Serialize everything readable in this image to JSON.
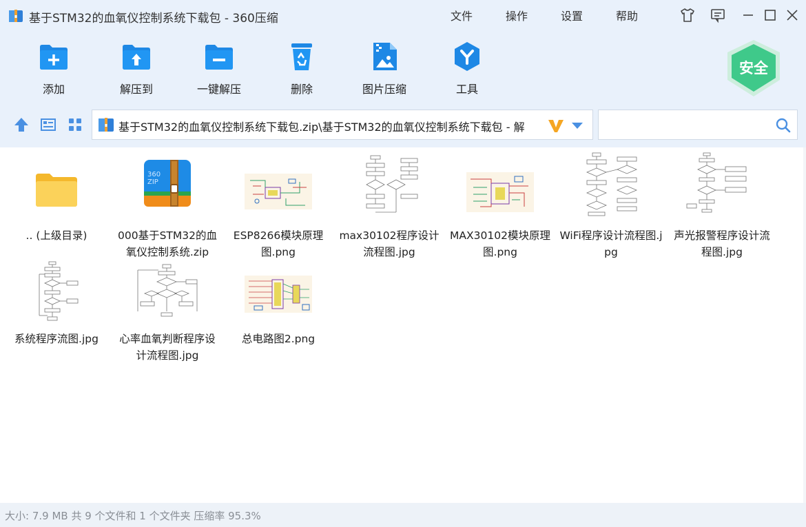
{
  "window": {
    "title": "基于STM32的血氧仪控制系统下载包 - 360压缩"
  },
  "menu": {
    "items": [
      "文件",
      "操作",
      "设置",
      "帮助"
    ]
  },
  "toolbar": {
    "add_label": "添加",
    "extract_to_label": "解压到",
    "one_click_extract_label": "一键解压",
    "delete_label": "删除",
    "image_compress_label": "图片压缩",
    "tools_label": "工具",
    "security_badge": "安全"
  },
  "address": {
    "path": "基于STM32的血氧仪控制系统下载包.zip\\基于STM32的血氧仪控制系统下载包 - 解"
  },
  "search": {
    "value": "",
    "placeholder": ""
  },
  "files": [
    {
      "name": ".. (上级目录)",
      "type": "folder-up"
    },
    {
      "name": "000基于STM32的血氧仪控制系统.zip",
      "type": "zip"
    },
    {
      "name": "ESP8266模块原理图.png",
      "type": "schematic"
    },
    {
      "name": "max30102程序设计流程图.jpg",
      "type": "flowchart"
    },
    {
      "name": "MAX30102模块原理图.png",
      "type": "schematic"
    },
    {
      "name": "WiFi程序设计流程图.jpg",
      "type": "flowchart"
    },
    {
      "name": "声光报警程序设计流程图.jpg",
      "type": "flowchart"
    },
    {
      "name": "系统程序流图.jpg",
      "type": "flowchart"
    },
    {
      "name": "心率血氧判断程序设计流程图.jpg",
      "type": "flowchart"
    },
    {
      "name": "总电路图2.png",
      "type": "schematic"
    }
  ],
  "status": {
    "text": "大小: 7.9 MB 共 9 个文件和 1 个文件夹 压缩率 95.3%"
  },
  "colors": {
    "accent_blue": "#1e88e5",
    "toolbar_bg": "#e9f1fb",
    "shield_green": "#3fc98a",
    "zip_orange": "#f08c1a",
    "folder_yellow": "#f9c843"
  }
}
